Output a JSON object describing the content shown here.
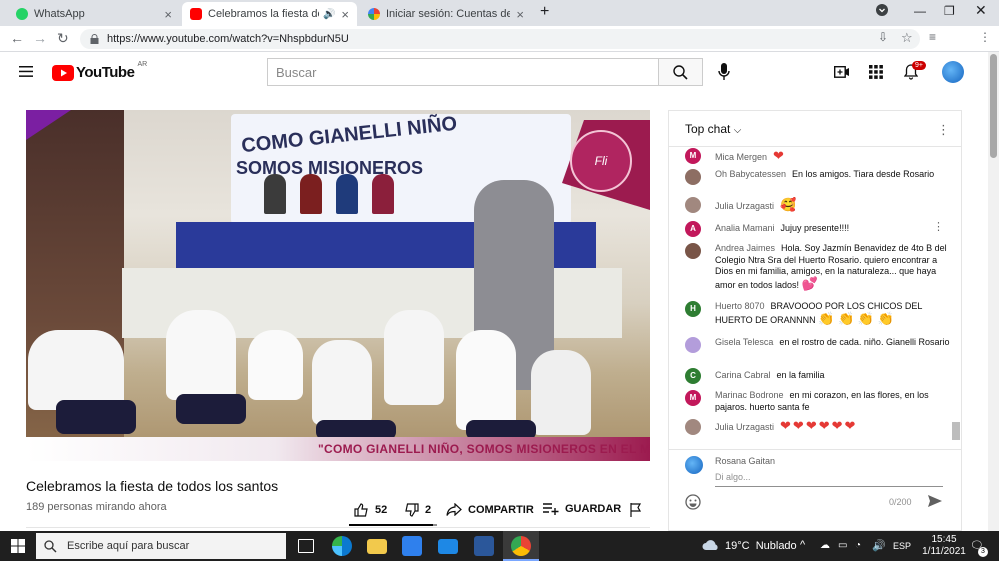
{
  "tabs": [
    {
      "label": "WhatsApp",
      "color": "#25d366"
    },
    {
      "label": "Celebramos la fiesta de todo",
      "color": "#ff0000"
    },
    {
      "label": "Iniciar sesión: Cuentas de Google",
      "color": "#4285f4"
    }
  ],
  "new_tab_label": "+",
  "address": {
    "url": "https://www.youtube.com/watch?v=NhspbdurN5U"
  },
  "youtube": {
    "logo_text": "YouTube",
    "region": "AR",
    "search_placeholder": "Buscar",
    "notif_badge": "9+"
  },
  "video": {
    "banner_top_1": "COMO GIANELLI NIÑO",
    "banner_top_2": "SOMOS MISIONEROS",
    "caption": "\"COMO GIANELLI NIÑO, SOMOS MISIONEROS EN EL M",
    "logo_text": "Fli",
    "title": "Celebramos la fiesta de todos los santos",
    "views": "189 personas mirando ahora"
  },
  "actions": {
    "likes": "52",
    "dislikes": "2",
    "share": "COMPARTIR",
    "save": "GUARDAR"
  },
  "chat": {
    "header": "Top chat",
    "messages": [
      {
        "initial": "M",
        "color": "#c2185b",
        "name": "Mica Mergen",
        "text": "",
        "emoji": "❤"
      },
      {
        "initial": "",
        "color": "#8d6e63",
        "name": "Oh Babycatessen",
        "text": "En los amigos. Tiara desde Rosario",
        "emoji": ""
      },
      {
        "initial": "",
        "color": "#a1887f",
        "name": "Julia Urzagasti",
        "text": "",
        "emoji": "🥰"
      },
      {
        "initial": "A",
        "color": "#c2185b",
        "name": "Analia Mamani",
        "text": "Jujuy presente!!!!",
        "emoji": ""
      },
      {
        "initial": "",
        "color": "#795548",
        "name": "Andrea Jaimes",
        "text": "Hola. Soy Jazmín Benavidez de 4to B del Colegio Ntra Sra del Huerto Rosario. quiero encontrar a Dios en mi familia, amigos, en la naturaleza... que haya amor en todos lados!",
        "emoji": "💕"
      },
      {
        "initial": "H",
        "color": "#2e7d32",
        "name": "Huerto 8070",
        "text": "BRAVOOOO POR LOS CHICOS DEL HUERTO DE ORANNNN",
        "emoji": "👏 👏 👏 👏"
      },
      {
        "initial": "",
        "color": "#b39ddb",
        "name": "Gisela Telesca",
        "text": "en el rostro de cada. niño. Gianelli Rosario",
        "emoji": ""
      },
      {
        "initial": "C",
        "color": "#2e7d32",
        "name": "Carina Cabral",
        "text": "en la familia",
        "emoji": ""
      },
      {
        "initial": "M",
        "color": "#c2185b",
        "name": "Marinac Bodrone",
        "text": "en mi corazon, en las flores, en los pajaros. huerto santa fe",
        "emoji": ""
      },
      {
        "initial": "",
        "color": "#a1887f",
        "name": "Julia Urzagasti",
        "text": "",
        "emoji": "❤❤❤❤❤❤"
      }
    ],
    "input_user": "Rosana Gaitan",
    "input_placeholder": "Di algo...",
    "counter": "0/200"
  },
  "taskbar": {
    "search_placeholder": "Escribe aquí para buscar",
    "weather": "19°C  Nublado",
    "lang": "ESP",
    "time": "15:45",
    "date": "1/11/2021",
    "notif_count": "3"
  }
}
